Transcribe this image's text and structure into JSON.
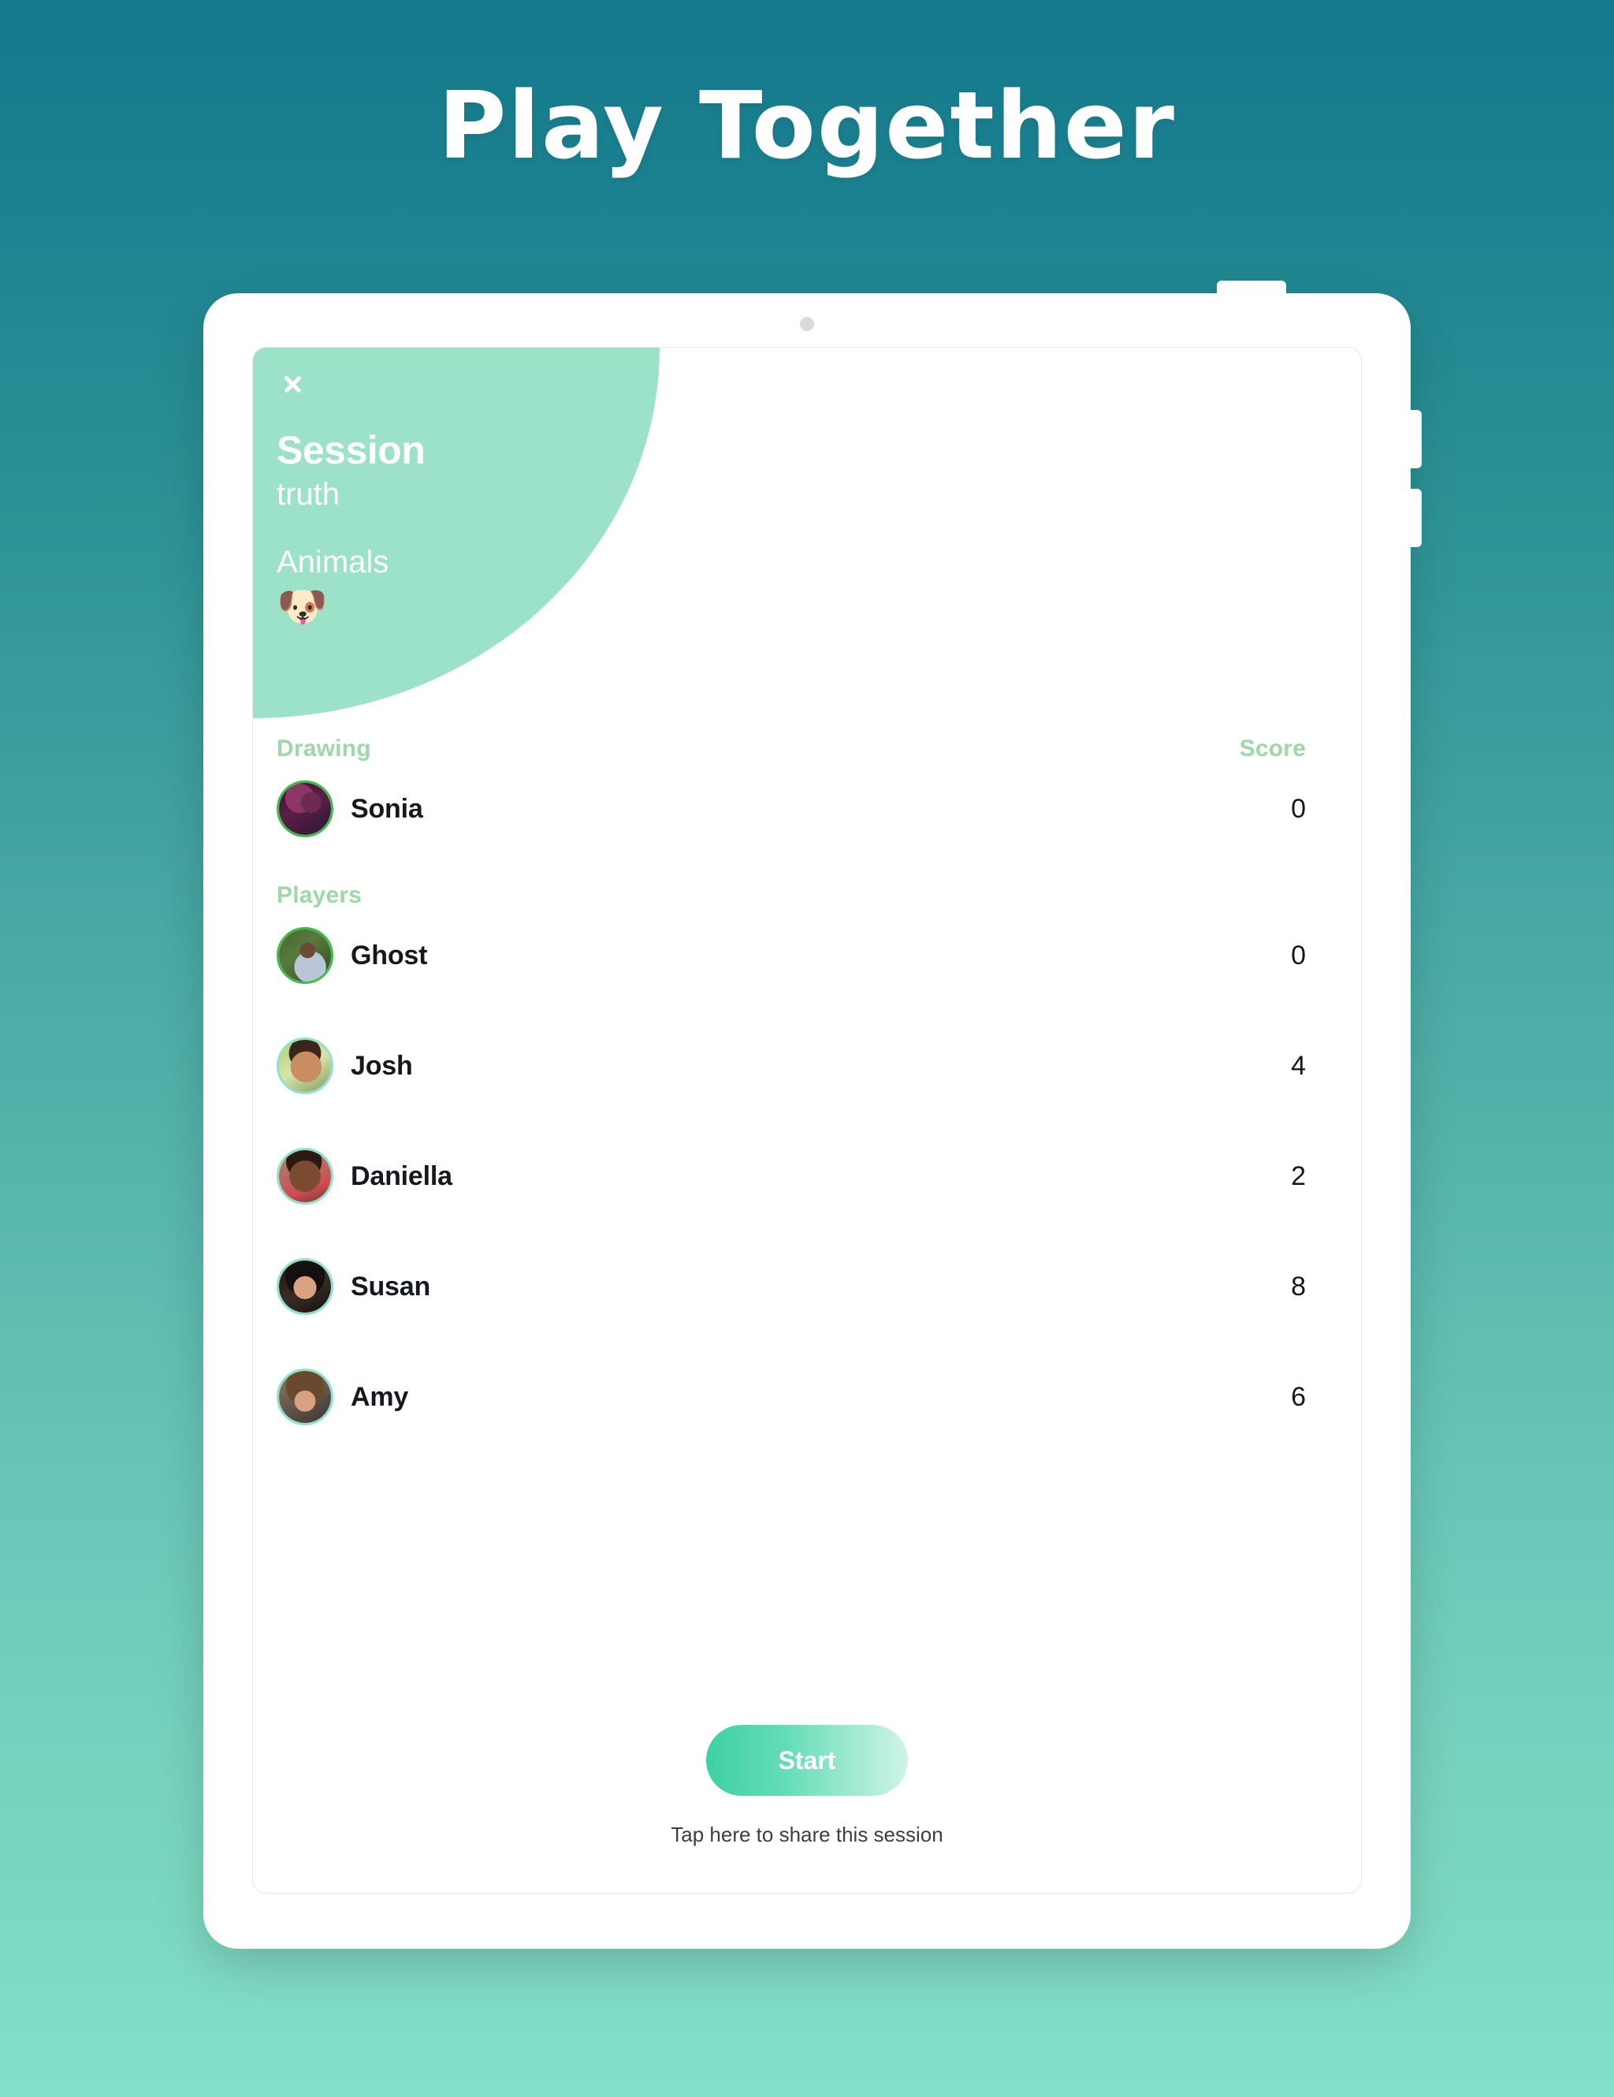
{
  "hero": {
    "title": "Play Together"
  },
  "device": {
    "camera_icon": "camera-dot",
    "power_button": "power-button",
    "volume_buttons": [
      "volume-up",
      "volume-down"
    ]
  },
  "session": {
    "close_icon": "close-x-icon",
    "title": "Session",
    "subtitle": "truth",
    "category": "Animals",
    "emoji": "🐶",
    "header_color": "#9ce2c8"
  },
  "columns": {
    "score_header": "Score"
  },
  "drawing": {
    "label": "Drawing",
    "players": [
      {
        "name": "Sonia",
        "score": "0",
        "ring": "green",
        "avatar": "av-sonia"
      }
    ]
  },
  "players": {
    "label": "Players",
    "list": [
      {
        "name": "Ghost",
        "score": "0",
        "ring": "green",
        "avatar": "av-ghost"
      },
      {
        "name": "Josh",
        "score": "4",
        "ring": "mint",
        "avatar": "av-josh"
      },
      {
        "name": "Daniella",
        "score": "2",
        "ring": "mint",
        "avatar": "av-daniella"
      },
      {
        "name": "Susan",
        "score": "8",
        "ring": "mint",
        "avatar": "av-susan"
      },
      {
        "name": "Amy",
        "score": "6",
        "ring": "mint",
        "avatar": "av-amy"
      }
    ]
  },
  "footer": {
    "start_label": "Start",
    "share_text": "Tap here to share this session"
  },
  "colors": {
    "background_top": "#15798d",
    "background_bottom": "#84dfc8",
    "mint_header": "#9ce2c8",
    "section_label": "#9ed7a8",
    "ring_green": "#3ebb4b",
    "ring_mint": "#8fe2c8"
  }
}
